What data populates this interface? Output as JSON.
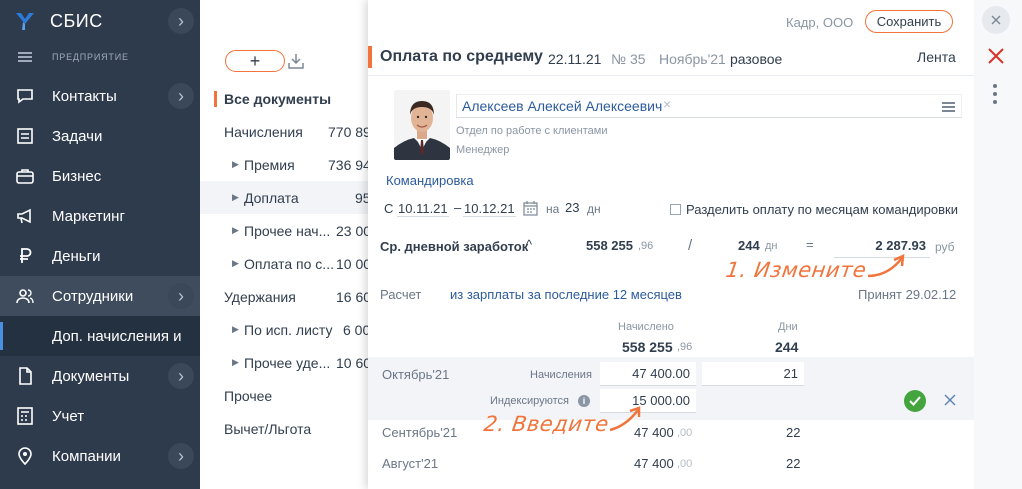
{
  "sidebar": {
    "brand": "СБИС",
    "section": "ПРЕДПРИЯТИЕ",
    "items": [
      {
        "label": "Контакты",
        "icon": "chat-bubble-icon"
      },
      {
        "label": "Задачи",
        "icon": "task-list-icon"
      },
      {
        "label": "Бизнес",
        "icon": "briefcase-icon"
      },
      {
        "label": "Маркетинг",
        "icon": "megaphone-icon"
      },
      {
        "label": "Деньги",
        "icon": "ruble-icon"
      },
      {
        "label": "Сотрудники",
        "icon": "people-icon"
      },
      {
        "label": "Доп. начисления и",
        "icon": ""
      },
      {
        "label": "Документы",
        "icon": "documents-icon"
      },
      {
        "label": "Учет",
        "icon": "calculator-icon"
      },
      {
        "label": "Компании",
        "icon": "location-pin-icon"
      }
    ]
  },
  "middle": {
    "add_label": "+",
    "rows": [
      {
        "label": "Все документы",
        "value": ""
      },
      {
        "label": "Начисления",
        "value": "770 89"
      },
      {
        "label": "Премия",
        "value": "736 94"
      },
      {
        "label": "Доплата",
        "value": "95"
      },
      {
        "label": "Прочее нач...",
        "value": "23 00"
      },
      {
        "label": "Оплата по с...",
        "value": "10 00"
      },
      {
        "label": "Удержания",
        "value": "16 60"
      },
      {
        "label": "По исп. листу",
        "value": "6 00"
      },
      {
        "label": "Прочее уде...",
        "value": "10 60"
      },
      {
        "label": "Прочее",
        "value": ""
      },
      {
        "label": "Вычет/Льгота",
        "value": ""
      }
    ]
  },
  "dialog": {
    "org": "Кадр, ООО",
    "save_label": "Сохранить",
    "title": "Оплата по среднему",
    "date": "22.11.21",
    "number_label": "№",
    "number": "35",
    "month": "Ноябрь'21",
    "type": "разовое",
    "feed": "Лента",
    "employee": {
      "name": "Алексеев Алексей Алексеевич",
      "department": "Отдел по работе с клиентами",
      "position": "Менеджер"
    },
    "trip": {
      "link": "Командировка",
      "from_label": "С",
      "from": "10.11.21",
      "dash": "–",
      "to": "10.12.21",
      "on_label": "на",
      "days": "23",
      "days_unit": "дн",
      "split_label": "Разделить оплату по месяцам командировки"
    },
    "average": {
      "label": "Ср. дневной заработок",
      "sum": "558 255",
      "sum_cents": ",96",
      "slash": "/",
      "days": "244",
      "days_unit": "дн",
      "equals": "=",
      "result": "2 287.93",
      "currency": "руб"
    },
    "calc": {
      "label": "Расчет",
      "value": "из зарплаты за последние 12 месяцев",
      "accepted": "Принят 29.02.12"
    },
    "table": {
      "h_accrued": "Начислено",
      "h_days": "Дни",
      "total_accrued": "558 255",
      "total_accrued_cents": ",96",
      "total_days": "244",
      "october": {
        "month": "Октябрь'21",
        "accrued_label": "Начисления",
        "accrued": "47 400.00",
        "days": "21",
        "indexed_label": "Индексируются",
        "indexed": "15 000.00"
      },
      "rows": [
        {
          "month": "Сентябрь'21",
          "accrued": "47 400",
          "cents": ",00",
          "days": "22"
        },
        {
          "month": "Август'21",
          "accrued": "47 400",
          "cents": ",00",
          "days": "22"
        }
      ]
    },
    "annotations": {
      "step1": "1. Измените",
      "step2": "2. Введите"
    }
  },
  "colors": {
    "sidebar_bg": "#2e3b4c",
    "accent": "#f0743b",
    "link": "#2c5b9c",
    "ok": "#44a53f",
    "cancel": "#d9332b"
  }
}
